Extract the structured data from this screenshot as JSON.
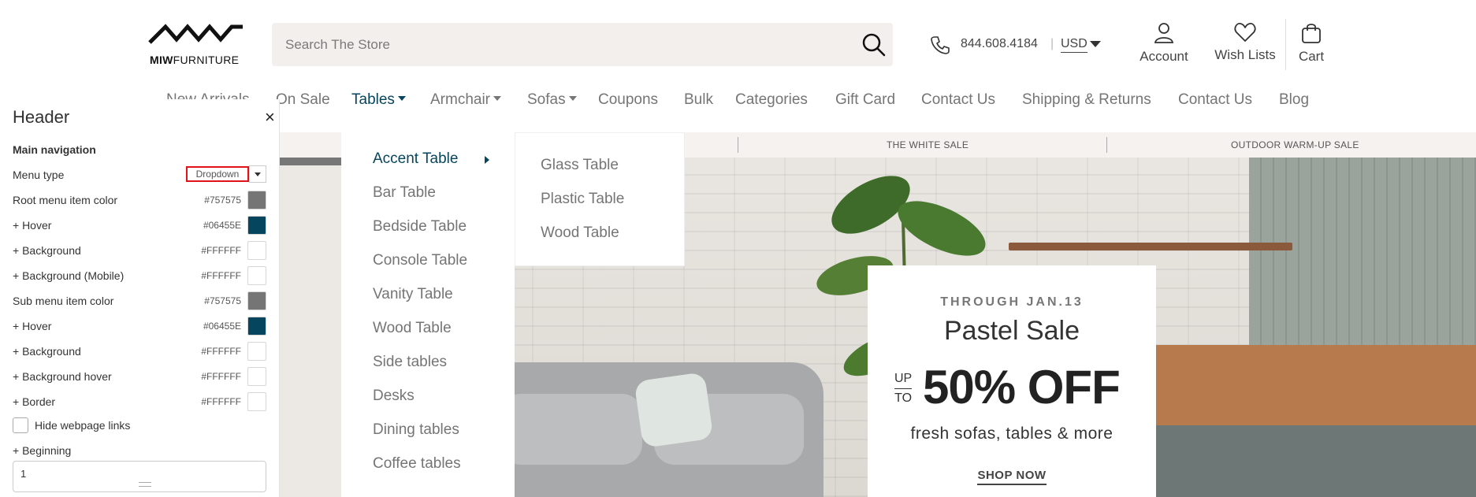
{
  "header": {
    "logo_text_bold": "MIW",
    "logo_text": "FURNITURE",
    "search_placeholder": "Search The Store",
    "phone": "844.608.4184",
    "separator": "|",
    "currency": "USD",
    "account_label": "Account",
    "wishlist_label": "Wish Lists",
    "cart_label": "Cart",
    "icons": [
      "search-icon",
      "phone-icon",
      "account-icon",
      "heart-icon",
      "bag-icon"
    ]
  },
  "nav": {
    "items": [
      {
        "label": "New Arrivals"
      },
      {
        "label": "On Sale"
      },
      {
        "label": "Tables",
        "dropdown": true
      },
      {
        "label": "Armchair",
        "dropdown": true
      },
      {
        "label": "Sofas",
        "dropdown": true
      },
      {
        "label": "Coupons"
      },
      {
        "label": "Bulk"
      },
      {
        "label": "Categories"
      },
      {
        "label": "Gift Card"
      },
      {
        "label": "Contact Us"
      },
      {
        "label": "Shipping & Returns"
      },
      {
        "label": "Contact Us"
      },
      {
        "label": "Blog"
      }
    ],
    "active_color": "#06455E",
    "root_color": "#757575"
  },
  "promo": {
    "items": [
      "THE WHITE SALE",
      "OUTDOOR WARM-UP SALE"
    ]
  },
  "dropdown": {
    "items": [
      "Accent Table",
      "Bar Table",
      "Bedside Table",
      "Console Table",
      "Vanity Table",
      "Wood Table",
      "Side tables",
      "Desks",
      "Dining tables",
      "Coffee tables"
    ],
    "submenu": [
      "Glass Table",
      "Plastic Table",
      "Wood Table"
    ]
  },
  "hero": {
    "through": "THROUGH JAN.13",
    "title": "Pastel Sale",
    "up": "UP",
    "to": "TO",
    "percent": "50% OFF",
    "subtitle": "fresh sofas, tables & more",
    "cta": "SHOP NOW"
  },
  "panel": {
    "title": "Header",
    "close": "×",
    "section": "Main navigation",
    "menu_type_label": "Menu type",
    "menu_type_value": "Dropdown",
    "rows": [
      {
        "label": "Root menu item color",
        "hex": "#757575",
        "color": "#757575"
      },
      {
        "label": "+ Hover",
        "hex": "#06455E",
        "color": "#06455E"
      },
      {
        "label": "+ Background",
        "hex": "#FFFFFF",
        "color": "#FFFFFF"
      },
      {
        "label": "+ Background (Mobile)",
        "hex": "#FFFFFF",
        "color": "#FFFFFF"
      },
      {
        "label": "Sub menu item color",
        "hex": "#757575",
        "color": "#757575"
      },
      {
        "label": "+ Hover",
        "hex": "#06455E",
        "color": "#06455E"
      },
      {
        "label": "+ Background",
        "hex": "#FFFFFF",
        "color": "#FFFFFF"
      },
      {
        "label": "+ Background hover",
        "hex": "#FFFFFF",
        "color": "#FFFFFF"
      },
      {
        "label": "+ Border",
        "hex": "#FFFFFF",
        "color": "#FFFFFF"
      }
    ],
    "hide_links_label": "Hide webpage links",
    "beginning_label": "+ Beginning",
    "beginning_value": "1"
  }
}
